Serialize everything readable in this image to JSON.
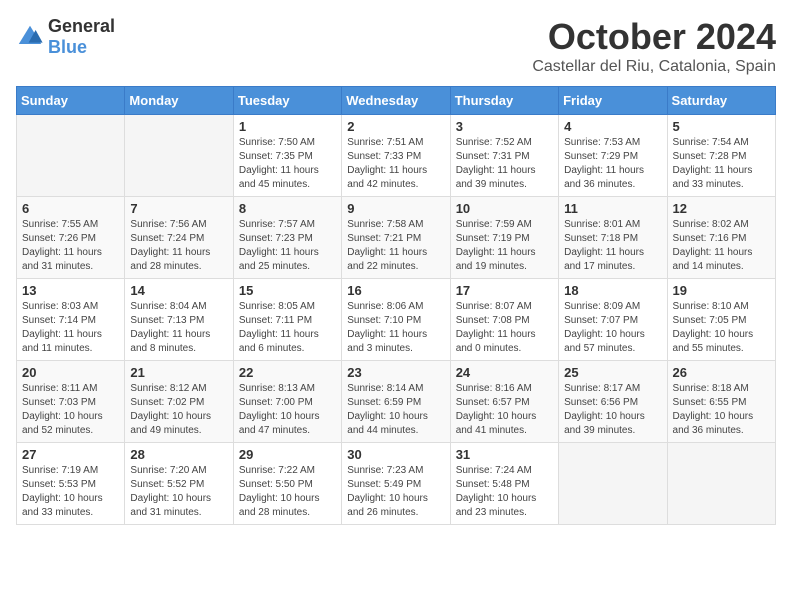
{
  "logo": {
    "text_general": "General",
    "text_blue": "Blue"
  },
  "title": "October 2024",
  "subtitle": "Castellar del Riu, Catalonia, Spain",
  "days_of_week": [
    "Sunday",
    "Monday",
    "Tuesday",
    "Wednesday",
    "Thursday",
    "Friday",
    "Saturday"
  ],
  "weeks": [
    [
      {
        "day": "",
        "info": ""
      },
      {
        "day": "",
        "info": ""
      },
      {
        "day": "1",
        "sunrise": "7:50 AM",
        "sunset": "7:35 PM",
        "daylight": "11 hours and 45 minutes."
      },
      {
        "day": "2",
        "sunrise": "7:51 AM",
        "sunset": "7:33 PM",
        "daylight": "11 hours and 42 minutes."
      },
      {
        "day": "3",
        "sunrise": "7:52 AM",
        "sunset": "7:31 PM",
        "daylight": "11 hours and 39 minutes."
      },
      {
        "day": "4",
        "sunrise": "7:53 AM",
        "sunset": "7:29 PM",
        "daylight": "11 hours and 36 minutes."
      },
      {
        "day": "5",
        "sunrise": "7:54 AM",
        "sunset": "7:28 PM",
        "daylight": "11 hours and 33 minutes."
      }
    ],
    [
      {
        "day": "6",
        "sunrise": "7:55 AM",
        "sunset": "7:26 PM",
        "daylight": "11 hours and 31 minutes."
      },
      {
        "day": "7",
        "sunrise": "7:56 AM",
        "sunset": "7:24 PM",
        "daylight": "11 hours and 28 minutes."
      },
      {
        "day": "8",
        "sunrise": "7:57 AM",
        "sunset": "7:23 PM",
        "daylight": "11 hours and 25 minutes."
      },
      {
        "day": "9",
        "sunrise": "7:58 AM",
        "sunset": "7:21 PM",
        "daylight": "11 hours and 22 minutes."
      },
      {
        "day": "10",
        "sunrise": "7:59 AM",
        "sunset": "7:19 PM",
        "daylight": "11 hours and 19 minutes."
      },
      {
        "day": "11",
        "sunrise": "8:01 AM",
        "sunset": "7:18 PM",
        "daylight": "11 hours and 17 minutes."
      },
      {
        "day": "12",
        "sunrise": "8:02 AM",
        "sunset": "7:16 PM",
        "daylight": "11 hours and 14 minutes."
      }
    ],
    [
      {
        "day": "13",
        "sunrise": "8:03 AM",
        "sunset": "7:14 PM",
        "daylight": "11 hours and 11 minutes."
      },
      {
        "day": "14",
        "sunrise": "8:04 AM",
        "sunset": "7:13 PM",
        "daylight": "11 hours and 8 minutes."
      },
      {
        "day": "15",
        "sunrise": "8:05 AM",
        "sunset": "7:11 PM",
        "daylight": "11 hours and 6 minutes."
      },
      {
        "day": "16",
        "sunrise": "8:06 AM",
        "sunset": "7:10 PM",
        "daylight": "11 hours and 3 minutes."
      },
      {
        "day": "17",
        "sunrise": "8:07 AM",
        "sunset": "7:08 PM",
        "daylight": "11 hours and 0 minutes."
      },
      {
        "day": "18",
        "sunrise": "8:09 AM",
        "sunset": "7:07 PM",
        "daylight": "10 hours and 57 minutes."
      },
      {
        "day": "19",
        "sunrise": "8:10 AM",
        "sunset": "7:05 PM",
        "daylight": "10 hours and 55 minutes."
      }
    ],
    [
      {
        "day": "20",
        "sunrise": "8:11 AM",
        "sunset": "7:03 PM",
        "daylight": "10 hours and 52 minutes."
      },
      {
        "day": "21",
        "sunrise": "8:12 AM",
        "sunset": "7:02 PM",
        "daylight": "10 hours and 49 minutes."
      },
      {
        "day": "22",
        "sunrise": "8:13 AM",
        "sunset": "7:00 PM",
        "daylight": "10 hours and 47 minutes."
      },
      {
        "day": "23",
        "sunrise": "8:14 AM",
        "sunset": "6:59 PM",
        "daylight": "10 hours and 44 minutes."
      },
      {
        "day": "24",
        "sunrise": "8:16 AM",
        "sunset": "6:57 PM",
        "daylight": "10 hours and 41 minutes."
      },
      {
        "day": "25",
        "sunrise": "8:17 AM",
        "sunset": "6:56 PM",
        "daylight": "10 hours and 39 minutes."
      },
      {
        "day": "26",
        "sunrise": "8:18 AM",
        "sunset": "6:55 PM",
        "daylight": "10 hours and 36 minutes."
      }
    ],
    [
      {
        "day": "27",
        "sunrise": "7:19 AM",
        "sunset": "5:53 PM",
        "daylight": "10 hours and 33 minutes."
      },
      {
        "day": "28",
        "sunrise": "7:20 AM",
        "sunset": "5:52 PM",
        "daylight": "10 hours and 31 minutes."
      },
      {
        "day": "29",
        "sunrise": "7:22 AM",
        "sunset": "5:50 PM",
        "daylight": "10 hours and 28 minutes."
      },
      {
        "day": "30",
        "sunrise": "7:23 AM",
        "sunset": "5:49 PM",
        "daylight": "10 hours and 26 minutes."
      },
      {
        "day": "31",
        "sunrise": "7:24 AM",
        "sunset": "5:48 PM",
        "daylight": "10 hours and 23 minutes."
      },
      {
        "day": "",
        "info": ""
      },
      {
        "day": "",
        "info": ""
      }
    ]
  ],
  "labels": {
    "sunrise": "Sunrise:",
    "sunset": "Sunset:",
    "daylight": "Daylight:"
  }
}
